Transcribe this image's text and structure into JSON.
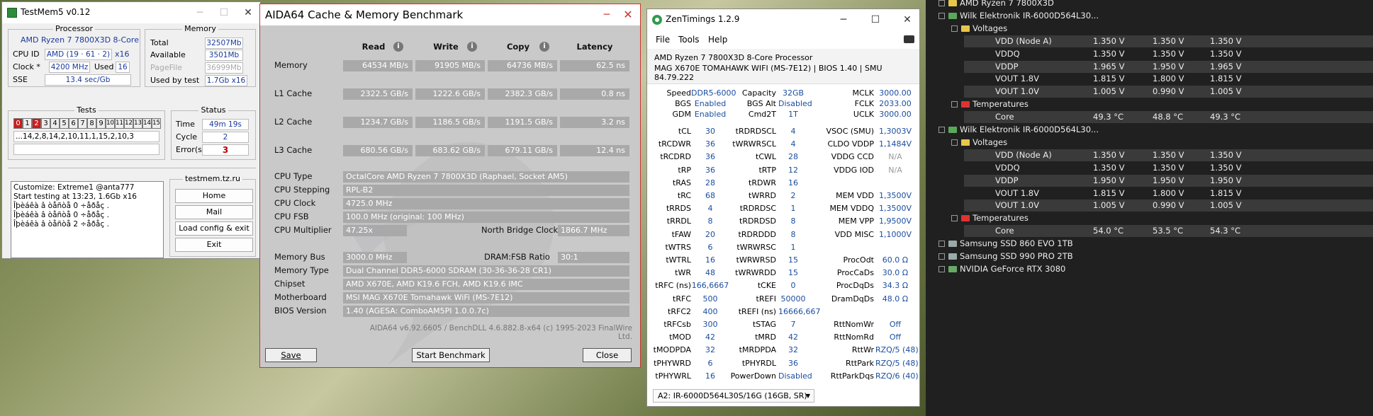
{
  "testmem": {
    "title": "TestMem5 v0.12",
    "processor_title": "Processor",
    "cpu_name": "AMD Ryzen 7 7800X3D 8-Core",
    "cpu_id_label": "CPU ID",
    "cpu_id": "AMD  (19 · 61 · 2)",
    "threads": "x16",
    "clock_label": "Clock *",
    "clock": "4200 MHz",
    "used_label": "Used",
    "used": "16",
    "sse_label": "SSE",
    "sse": "13.4 sec/Gb",
    "memory_title": "Memory",
    "total_label": "Total",
    "total": "32507Mb",
    "available_label": "Available",
    "available": "3501Mb",
    "pagefile_label": "PageFile",
    "pagefile": "36999Mb",
    "usedby_label": "Used by test",
    "usedby": "1.7Gb x16",
    "tests_title": "Tests",
    "test_cells": [
      "0",
      "1",
      "2",
      "3",
      "4",
      "5",
      "6",
      "7",
      "8",
      "9",
      "10",
      "11",
      "12",
      "13",
      "14",
      "15"
    ],
    "sequence": "...14,2,8,14,2,10,11,1,15,2,10,3",
    "status_title": "Status",
    "time_label": "Time",
    "time": "49m 19s",
    "cycle_label": "Cycle",
    "cycle": "2",
    "errors_label": "Error(s)",
    "errors": "3",
    "log": "Customize: Extreme1 @anta777\nStart testing at 13:23, 1.6Gb x16\nÎþèáêà â òåñòå 0 ÷åðåç .\nÎþèáêà â òåñòå 0 ÷åðåç .\nÎþèáêà â òåñòå 2 ÷åðåç .",
    "site": "testmem.tz.ru",
    "buttons": [
      "Home",
      "Mail",
      "Load config & exit",
      "Exit"
    ]
  },
  "aida": {
    "title": "AIDA64 Cache & Memory Benchmark",
    "headers": [
      "Read",
      "Write",
      "Copy",
      "Latency"
    ],
    "rows": [
      {
        "label": "Memory",
        "read": "64534 MB/s",
        "write": "91905 MB/s",
        "copy": "64736 MB/s",
        "latency": "62.5 ns"
      },
      {
        "label": "L1 Cache",
        "read": "2322.5 GB/s",
        "write": "1222.6 GB/s",
        "copy": "2382.3 GB/s",
        "latency": "0.8 ns"
      },
      {
        "label": "L2 Cache",
        "read": "1234.7 GB/s",
        "write": "1186.5 GB/s",
        "copy": "1191.5 GB/s",
        "latency": "3.2 ns"
      },
      {
        "label": "L3 Cache",
        "read": "680.56 GB/s",
        "write": "683.62 GB/s",
        "copy": "679.11 GB/s",
        "latency": "12.4 ns"
      }
    ],
    "cpu_type_label": "CPU Type",
    "cpu_type": "OctalCore AMD Ryzen 7 7800X3D  (Raphael, Socket AM5)",
    "cpu_stepping_label": "CPU Stepping",
    "cpu_stepping": "RPL-B2",
    "cpu_clock_label": "CPU Clock",
    "cpu_clock": "4725.0 MHz",
    "cpu_fsb_label": "CPU FSB",
    "cpu_fsb": "100.0 MHz  (original: 100 MHz)",
    "cpu_mult_label": "CPU Multiplier",
    "cpu_mult": "47.25x",
    "nb_clock_label": "North Bridge Clock",
    "nb_clock": "1866.7 MHz",
    "mem_bus_label": "Memory Bus",
    "mem_bus": "3000.0 MHz",
    "ratio_label": "DRAM:FSB Ratio",
    "ratio": "30:1",
    "mem_type_label": "Memory Type",
    "mem_type": "Dual Channel DDR5-6000 SDRAM  (30-36-36-28 CR1)",
    "chipset_label": "Chipset",
    "chipset": "AMD X670E, AMD K19.6 FCH, AMD K19.6 IMC",
    "mobo_label": "Motherboard",
    "mobo": "MSI MAG X670E Tomahawk WiFi (MS-7E12)",
    "bios_label": "BIOS Version",
    "bios": "1.40  (AGESA: ComboAM5PI 1.0.0.7c)",
    "footer": "AIDA64 v6.92.6605 / BenchDLL 4.6.882.8-x64  (c) 1995-2023 FinalWire Ltd.",
    "save": "Save",
    "start": "Start Benchmark",
    "close": "Close"
  },
  "zen": {
    "title": "ZenTimings 1.2.9",
    "menu": [
      "File",
      "Tools",
      "Help"
    ],
    "cpu": "AMD Ryzen 7 7800X3D 8-Core Processor",
    "board": "MAG X670E TOMAHAWK WIFI (MS-7E12) | BIOS 1.40 | SMU 84.79.222",
    "top": [
      [
        "Speed",
        "DDR5-6000",
        "Capacity",
        "32GB",
        "MCLK",
        "3000.00"
      ],
      [
        "BGS",
        "Enabled",
        "BGS Alt",
        "Disabled",
        "FCLK",
        "2033.00"
      ],
      [
        "GDM",
        "Enabled",
        "Cmd2T",
        "1T",
        "UCLK",
        "3000.00"
      ]
    ],
    "timings": [
      [
        "tCL",
        "30",
        "tRDRDSCL",
        "4",
        "VSOC (SMU)",
        "1,3003V"
      ],
      [
        "tRCDWR",
        "36",
        "tWRWRSCL",
        "4",
        "CLDO VDDP",
        "1,1484V"
      ],
      [
        "tRCDRD",
        "36",
        "tCWL",
        "28",
        "VDDG CCD",
        "N/A"
      ],
      [
        "tRP",
        "36",
        "tRTP",
        "12",
        "VDDG IOD",
        "N/A"
      ],
      [
        "tRAS",
        "28",
        "tRDWR",
        "16",
        "",
        ""
      ],
      [
        "tRC",
        "68",
        "tWRRD",
        "2",
        "MEM VDD",
        "1,3500V"
      ],
      [
        "tRRDS",
        "4",
        "tRDRDSC",
        "1",
        "MEM VDDQ",
        "1,3500V"
      ],
      [
        "tRRDL",
        "8",
        "tRDRDSD",
        "8",
        "MEM VPP",
        "1,9500V"
      ],
      [
        "tFAW",
        "20",
        "tRDRDDD",
        "8",
        "VDD MISC",
        "1,1000V"
      ],
      [
        "tWTRS",
        "6",
        "tWRWRSC",
        "1",
        "",
        ""
      ],
      [
        "tWTRL",
        "16",
        "tWRWRSD",
        "15",
        "ProcOdt",
        "60.0 Ω"
      ],
      [
        "tWR",
        "48",
        "tWRWRDD",
        "15",
        "ProcCaDs",
        "30.0 Ω"
      ],
      [
        "tRFC (ns)",
        "166,6667",
        "tCKE",
        "0",
        "ProcDqDs",
        "34.3 Ω"
      ],
      [
        "tRFC",
        "500",
        "tREFI",
        "50000",
        "DramDqDs",
        "48.0 Ω"
      ],
      [
        "tRFC2",
        "400",
        "tREFI (ns)",
        "16666,667",
        "",
        ""
      ],
      [
        "tRFCsb",
        "300",
        "tSTAG",
        "7",
        "RttNomWr",
        "Off"
      ],
      [
        "tMOD",
        "42",
        "tMRD",
        "42",
        "RttNomRd",
        "Off"
      ],
      [
        "tMODPDA",
        "32",
        "tMRDPDA",
        "32",
        "RttWr",
        "RZQ/5 (48)"
      ],
      [
        "tPHYWRD",
        "6",
        "tPHYRDL",
        "36",
        "RttPark",
        "RZQ/5 (48)"
      ],
      [
        "tPHYWRL",
        "16",
        "PowerDown",
        "Disabled",
        "RttParkDqs",
        "RZQ/6 (40)"
      ]
    ],
    "module": "A2: IR-6000D564L30S/16G (16GB, SR)"
  },
  "hwinfo": {
    "rows": [
      {
        "lvl": 0,
        "name": "AMD Ryzen 7 7800X3D",
        "kind": "cpu"
      },
      {
        "lvl": 0,
        "name": "Wilk Elektronik IR-6000D564L30...",
        "kind": "mem"
      },
      {
        "lvl": 1,
        "name": "Voltages",
        "kind": "volt"
      },
      {
        "lvl": 2,
        "name": "VDD (Node A)",
        "v": [
          "1.350 V",
          "1.350 V",
          "1.350 V"
        ],
        "hl": true
      },
      {
        "lvl": 2,
        "name": "VDDQ",
        "v": [
          "1.350 V",
          "1.350 V",
          "1.350 V"
        ]
      },
      {
        "lvl": 2,
        "name": "VDDP",
        "v": [
          "1.965 V",
          "1.950 V",
          "1.965 V"
        ],
        "hl": true
      },
      {
        "lvl": 2,
        "name": "VOUT 1.8V",
        "v": [
          "1.815 V",
          "1.800 V",
          "1.815 V"
        ]
      },
      {
        "lvl": 2,
        "name": "VOUT 1.0V",
        "v": [
          "1.005 V",
          "0.990 V",
          "1.005 V"
        ],
        "hl": true
      },
      {
        "lvl": 1,
        "name": "Temperatures",
        "kind": "temp"
      },
      {
        "lvl": 2,
        "name": "Core",
        "v": [
          "49.3 °C",
          "48.8 °C",
          "49.3 °C"
        ],
        "hl": true
      },
      {
        "lvl": 0,
        "name": "Wilk Elektronik IR-6000D564L30...",
        "kind": "mem"
      },
      {
        "lvl": 1,
        "name": "Voltages",
        "kind": "volt"
      },
      {
        "lvl": 2,
        "name": "VDD (Node A)",
        "v": [
          "1.350 V",
          "1.350 V",
          "1.350 V"
        ],
        "hl": true
      },
      {
        "lvl": 2,
        "name": "VDDQ",
        "v": [
          "1.350 V",
          "1.350 V",
          "1.350 V"
        ]
      },
      {
        "lvl": 2,
        "name": "VDDP",
        "v": [
          "1.950 V",
          "1.950 V",
          "1.950 V"
        ],
        "hl": true
      },
      {
        "lvl": 2,
        "name": "VOUT 1.8V",
        "v": [
          "1.815 V",
          "1.800 V",
          "1.815 V"
        ]
      },
      {
        "lvl": 2,
        "name": "VOUT 1.0V",
        "v": [
          "1.005 V",
          "0.990 V",
          "1.005 V"
        ],
        "hl": true
      },
      {
        "lvl": 1,
        "name": "Temperatures",
        "kind": "temp"
      },
      {
        "lvl": 2,
        "name": "Core",
        "v": [
          "54.0 °C",
          "53.5 °C",
          "54.3 °C"
        ],
        "hl": true
      },
      {
        "lvl": 0,
        "name": "Samsung SSD 860 EVO 1TB",
        "kind": "disk"
      },
      {
        "lvl": 0,
        "name": "Samsung SSD 990 PRO 2TB",
        "kind": "disk"
      },
      {
        "lvl": 0,
        "name": "NVIDIA GeForce RTX 3080",
        "kind": "gpu"
      }
    ]
  }
}
